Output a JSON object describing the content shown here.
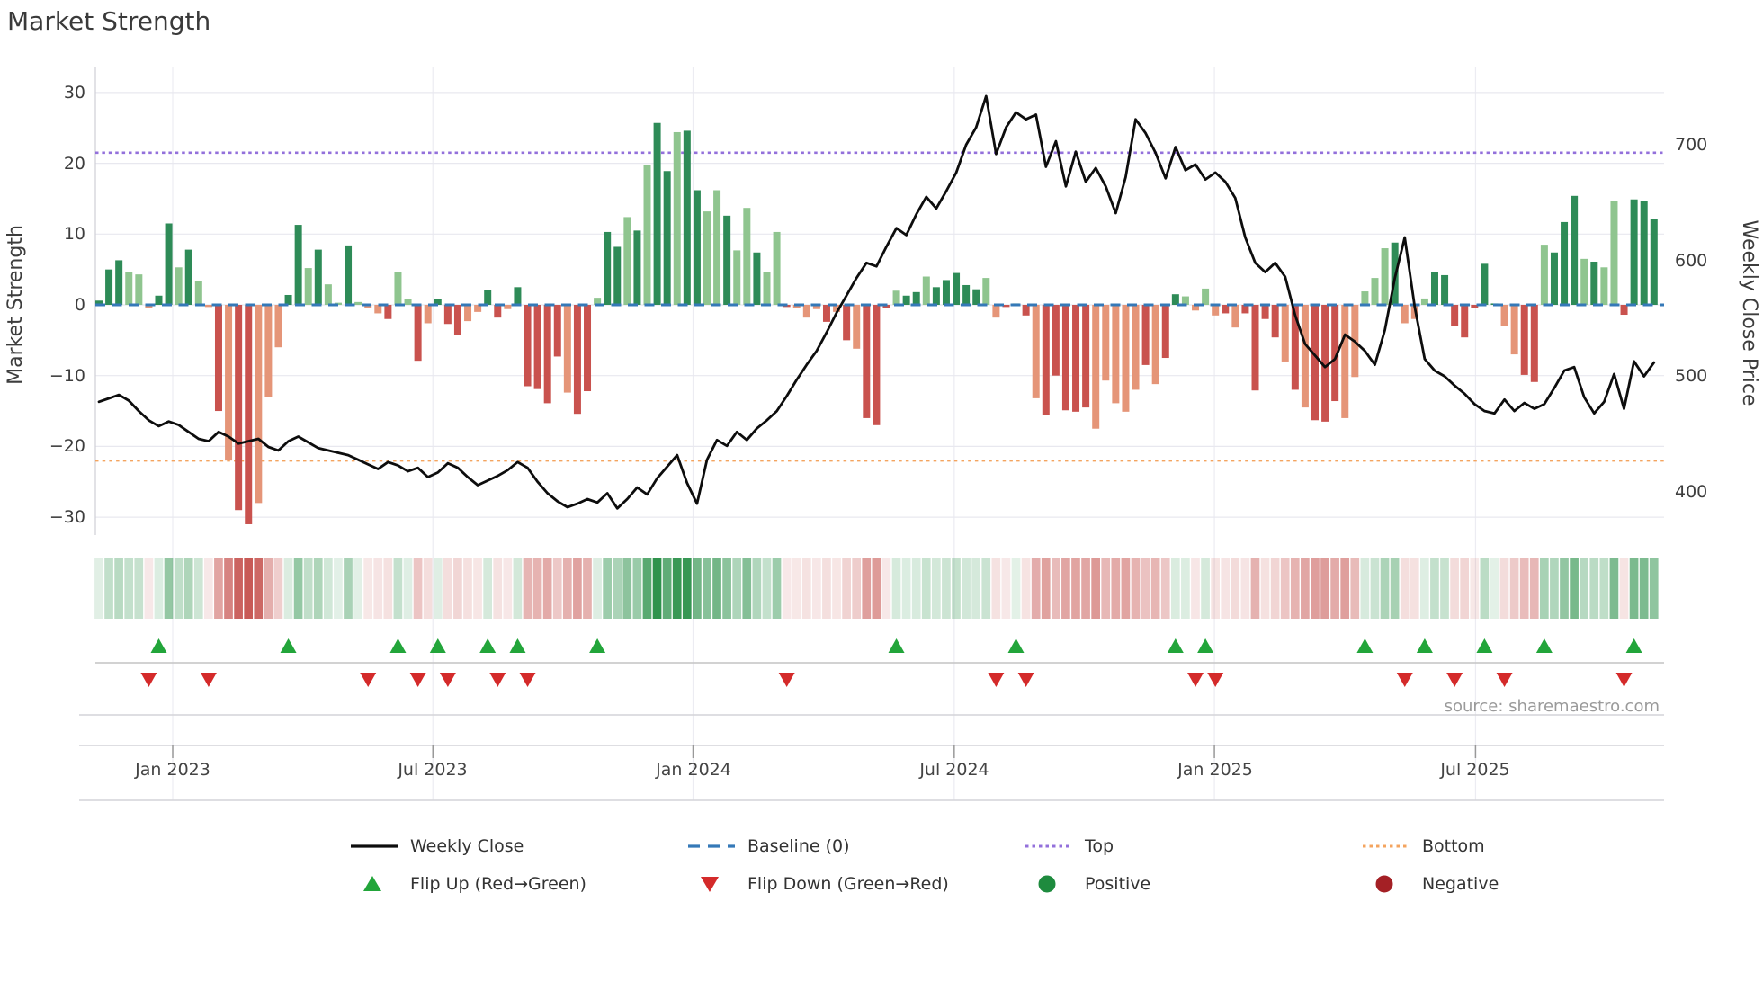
{
  "title": "Market Strength",
  "source": "source: sharemaestro.com",
  "colors": {
    "bar_green_dark": "#2e8b57",
    "bar_green_light": "#8fc58f",
    "bar_red_dark": "#c9524e",
    "bar_red_salmon": "#e59578",
    "strip_green_rgb": "34,140,66",
    "strip_red_rgb": "197,81,77",
    "close_line": "#0d0d0d",
    "baseline": "#3579b8",
    "top_line": "#9370db",
    "bottom_line": "#f4a45f",
    "flip_up": "#22a53a",
    "flip_down": "#d42a2a",
    "positive": "#1e8b3e",
    "negative": "#a42025",
    "grid_h": "#e8e8ef",
    "grid_v": "#ececf2",
    "spine": "#cfcfd6",
    "separator": "#c4c4c4",
    "lane_line": "#d4d4d8",
    "tick_mark": "#999999"
  },
  "legend": {
    "weekly_close": "Weekly Close",
    "baseline": "Baseline (0)",
    "top": "Top",
    "bottom": "Bottom",
    "flip_up": "Flip Up (Red→Green)",
    "flip_down": "Flip Down (Green→Red)",
    "positive": "Positive",
    "negative": "Negative"
  },
  "chart_data": {
    "type": [
      "bar",
      "line",
      "heatmap",
      "scatter"
    ],
    "title": "Market Strength",
    "ylabel_left": "Market Strength",
    "ylabel_right": "Weekly Close Price",
    "ylim_left": [
      -32.5,
      33.5
    ],
    "ylim_right": [
      363,
      767
    ],
    "grid": true,
    "legend_position": "bottom",
    "baseline_value": 0,
    "top_line_value": 21.5,
    "bottom_line_value": -22,
    "left_ticks": [
      "30",
      "20",
      "10",
      "0",
      "−10",
      "−20",
      "−30"
    ],
    "left_tick_values": [
      30,
      20,
      10,
      0,
      -10,
      -20,
      -30
    ],
    "right_ticks": [
      "700",
      "600",
      "500",
      "400"
    ],
    "right_tick_values": [
      700,
      600,
      500,
      400
    ],
    "x_ticks": [
      {
        "label": "Jan 2023",
        "week": 7.4
      },
      {
        "label": "Jul 2023",
        "week": 33.5
      },
      {
        "label": "Jan 2024",
        "week": 59.6
      },
      {
        "label": "Jul 2024",
        "week": 85.8
      },
      {
        "label": "Jan 2025",
        "week": 111.9
      },
      {
        "label": "Jul 2025",
        "week": 138.1
      }
    ],
    "weeks": 157,
    "market_strength": [
      0.6,
      5.0,
      6.3,
      4.7,
      4.3,
      -0.4,
      1.3,
      11.5,
      5.3,
      7.8,
      3.4,
      -0.3,
      -15.0,
      -22.0,
      -29.0,
      -31.0,
      -28.0,
      -13.0,
      -6.0,
      1.4,
      11.3,
      5.2,
      7.8,
      2.9,
      0.3,
      8.4,
      0.4,
      -0.5,
      -1.2,
      -2.0,
      4.6,
      0.8,
      -7.9,
      -2.6,
      0.8,
      -2.7,
      -4.3,
      -2.3,
      -1.0,
      2.1,
      -1.8,
      -0.6,
      2.5,
      -11.5,
      -11.9,
      -13.9,
      -7.3,
      -12.4,
      -15.4,
      -12.2,
      1.0,
      10.3,
      8.2,
      12.4,
      10.5,
      19.7,
      25.7,
      18.9,
      24.4,
      24.6,
      16.2,
      13.2,
      16.2,
      12.6,
      7.7,
      13.7,
      7.4,
      4.7,
      10.3,
      -0.3,
      -0.5,
      -1.8,
      -0.6,
      -2.4,
      -1.0,
      -5.0,
      -6.2,
      -16.0,
      -17.0,
      -0.4,
      2.0,
      1.3,
      1.8,
      4.0,
      2.5,
      3.5,
      4.5,
      2.8,
      2.2,
      3.8,
      -1.8,
      -0.3,
      0.2,
      -1.5,
      -13.2,
      -15.6,
      -10.0,
      -14.9,
      -15.1,
      -14.5,
      -17.5,
      -10.7,
      -13.9,
      -15.1,
      -12.0,
      -8.5,
      -11.2,
      -7.5,
      1.5,
      1.2,
      -0.8,
      2.3,
      -1.5,
      -1.2,
      -3.2,
      -1.2,
      -12.1,
      -2.0,
      -4.6,
      -8.0,
      -12.0,
      -14.5,
      -16.3,
      -16.5,
      -13.6,
      -16.0,
      -10.2,
      1.9,
      3.8,
      8.0,
      8.8,
      -2.6,
      -2.0,
      0.9,
      4.7,
      4.2,
      -3.0,
      -4.6,
      -0.5,
      5.8,
      0.2,
      -3.0,
      -7.0,
      -9.9,
      -10.9,
      8.5,
      7.4,
      11.7,
      15.4,
      6.5,
      6.1,
      5.3,
      14.7,
      -1.4,
      14.9,
      14.7,
      12.1
    ],
    "bar_tone": "dddllsddldlsdsddsssddldlldlssdlldldddssddsdddddsddsddldlddlddlldlldlldsssdsdsdddsddldddddlldddsdddddsssssdsddssssdlddddsdsdddsssssdsssdddddddssddldddldllddddddlldllldsddl",
    "weekly_close": [
      478,
      481,
      484,
      479,
      470,
      462,
      457,
      461,
      458,
      452,
      446,
      444,
      452,
      448,
      442,
      444,
      446,
      439,
      436,
      444,
      448,
      443,
      438,
      436,
      434,
      432,
      428,
      424,
      420,
      426,
      423,
      418,
      421,
      413,
      417,
      425,
      421,
      413,
      406,
      410,
      414,
      419,
      426,
      421,
      409,
      399,
      392,
      387,
      390,
      394,
      391,
      399,
      386,
      394,
      404,
      398,
      412,
      422,
      432,
      408,
      390,
      428,
      445,
      440,
      452,
      445,
      455,
      462,
      470,
      483,
      497,
      510,
      522,
      538,
      555,
      570,
      585,
      598,
      595,
      612,
      628,
      622,
      640,
      655,
      645,
      660,
      676,
      700,
      715,
      742,
      692,
      715,
      728,
      722,
      726,
      681,
      703,
      664,
      694,
      668,
      680,
      664,
      641,
      672,
      722,
      710,
      693,
      671,
      698,
      678,
      683,
      670,
      676,
      668,
      654,
      620,
      598,
      590,
      598,
      586,
      553,
      528,
      518,
      508,
      515,
      536,
      530,
      522,
      510,
      540,
      585,
      620,
      560,
      515,
      505,
      500,
      492,
      485,
      476,
      470,
      468,
      480,
      470,
      477,
      472,
      476,
      490,
      505,
      508,
      482,
      468,
      478,
      502,
      472,
      513,
      500,
      512
    ],
    "flip_up_weeks": [
      6,
      19,
      30,
      34,
      39,
      42,
      50,
      80,
      92,
      108,
      111,
      127,
      133,
      139,
      145,
      154
    ],
    "flip_down_weeks": [
      5,
      11,
      27,
      32,
      35,
      40,
      43,
      69,
      90,
      93,
      110,
      112,
      131,
      136,
      141,
      153
    ]
  }
}
